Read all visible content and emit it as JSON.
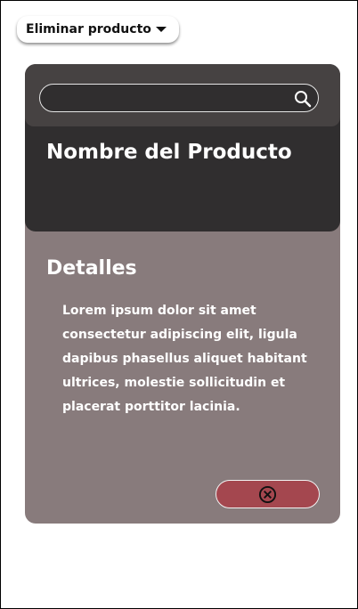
{
  "dropdown": {
    "label": "Eliminar producto",
    "icon": "chevron-down-icon"
  },
  "search": {
    "value": "",
    "icon": "search-icon"
  },
  "product": {
    "name": "Nombre del Producto"
  },
  "details": {
    "heading": "Detalles",
    "body": "Lorem ipsum dolor sit amet consectetur adipiscing elit, ligula dapibus phasellus aliquet habitant ultrices, molestie sollicitudin et placerat porttitor lacinia."
  },
  "remove_button": {
    "icon": "close-circle-icon"
  },
  "colors": {
    "card_background": "#887b7c",
    "header_background": "#302e2f",
    "search_band": "#464242",
    "remove_button": "#a4474f"
  }
}
